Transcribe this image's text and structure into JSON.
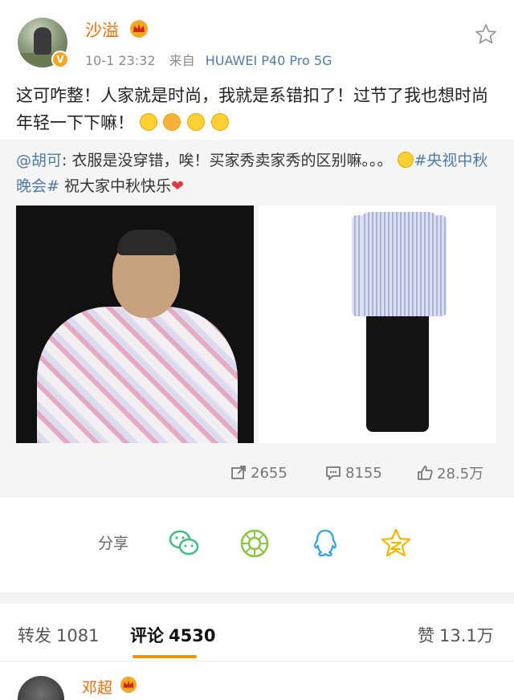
{
  "post": {
    "username": "沙溢",
    "time": "10-1 23:32",
    "via_label": "来自",
    "device": "HUAWEI P40 Pro 5G",
    "text": "这可咋整！人家就是时尚，我就是系错扣了！过节了我也想时尚年轻一下下嘛！",
    "emojis": [
      "laugh-cry-emoji",
      "kiss-emoji",
      "grin-emoji",
      "grin-emoji"
    ]
  },
  "repost": {
    "author": "@胡可",
    "text": ": 衣服是没穿错，唉！买家秀卖家秀的区别嘛。。。",
    "hashtag": "#央视中秋晚会#",
    "tail": " 祝大家中秋快乐",
    "images": [
      "photo-performer",
      "photo-model-outfit"
    ]
  },
  "stats": {
    "reposts": "2655",
    "comments": "8155",
    "likes": "28.5万"
  },
  "share": {
    "label": "分享",
    "targets": [
      "wechat-icon",
      "moments-icon",
      "qq-icon",
      "qzone-icon"
    ]
  },
  "tabs": [
    {
      "label": "转发",
      "count": "1081"
    },
    {
      "label": "评论",
      "count": "4530"
    },
    {
      "label": "赞",
      "count": "13.1万"
    }
  ],
  "comment": {
    "username": "邓超"
  },
  "colors": {
    "username": "#f06c00",
    "link": "#4d7ba8",
    "accent": "#f29400"
  }
}
